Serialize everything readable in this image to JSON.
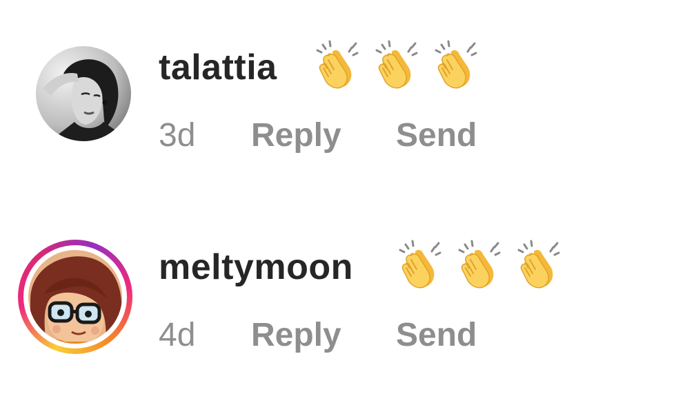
{
  "comments": [
    {
      "username": "talattia",
      "reactions": [
        "clapping-hands-emoji",
        "clapping-hands-emoji",
        "clapping-hands-emoji"
      ],
      "age": "3d",
      "reply_label": "Reply",
      "send_label": "Send",
      "avatar": "grayscale-portrait-photo"
    },
    {
      "username": "meltymoon",
      "reactions": [
        "clapping-hands-emoji",
        "clapping-hands-emoji",
        "clapping-hands-emoji"
      ],
      "age": "4d",
      "reply_label": "Reply",
      "send_label": "Send",
      "avatar": "cartoon-character-with-glasses",
      "story_ring": true
    }
  ],
  "colors": {
    "username": "#262626",
    "meta": "#8e8e8e",
    "story_ring": [
      "#f9ce34",
      "#ee2a7b",
      "#962fbf",
      "#f58529"
    ]
  }
}
